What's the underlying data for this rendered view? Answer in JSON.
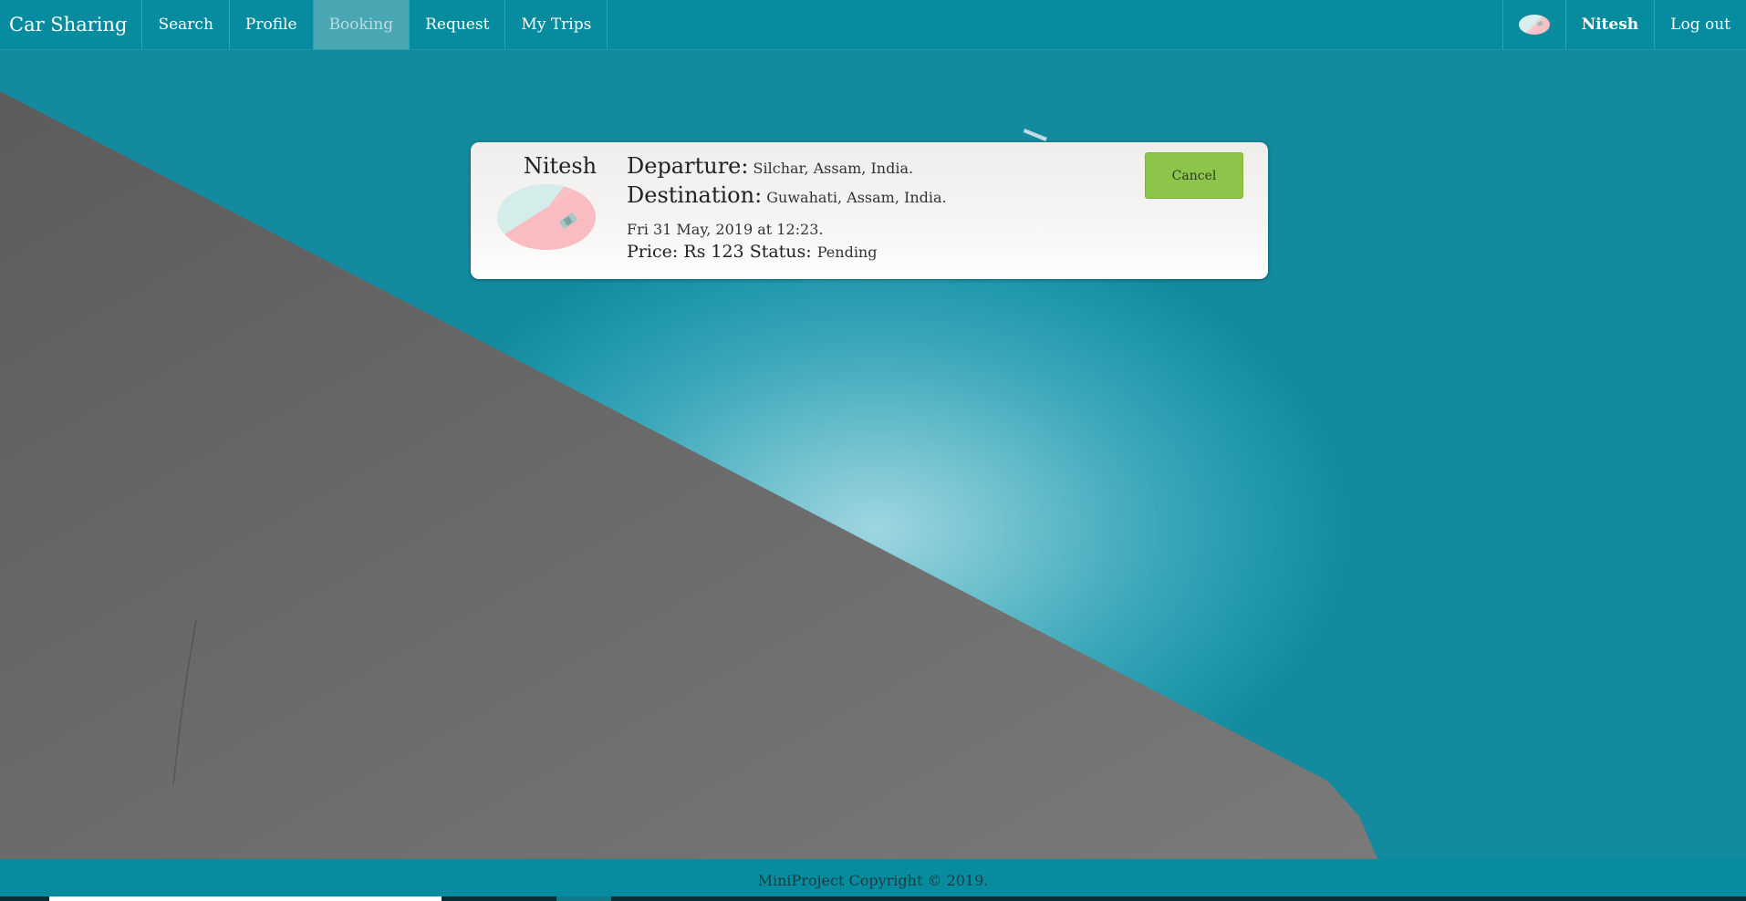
{
  "nav": {
    "brand": "Car Sharing",
    "items": [
      {
        "label": "Search",
        "active": false
      },
      {
        "label": "Profile",
        "active": false
      },
      {
        "label": "Booking",
        "active": true
      },
      {
        "label": "Request",
        "active": false
      },
      {
        "label": "My Trips",
        "active": false
      }
    ],
    "user_name": "Nitesh",
    "logout_label": "Log out"
  },
  "booking": {
    "driver_name": "Nitesh",
    "departure_label": "Departure:",
    "departure_value": "Silchar, Assam, India.",
    "destination_label": "Destination:",
    "destination_value": "Guwahati, Assam, India.",
    "datetime": "Fri 31 May, 2019 at 12:23.",
    "price_label": "Price: Rs 123",
    "status_label": "Status:",
    "status_value": "Pending",
    "cancel_label": "Cancel"
  },
  "footer": {
    "copyright": "MiniProject Copyright © 2019."
  },
  "colors": {
    "navbar": "#078c9f",
    "active_tab": "#4aa6b3",
    "cancel_button": "#8cc54a",
    "sky": "#1e96aa",
    "wall": "#6d6d6d"
  }
}
